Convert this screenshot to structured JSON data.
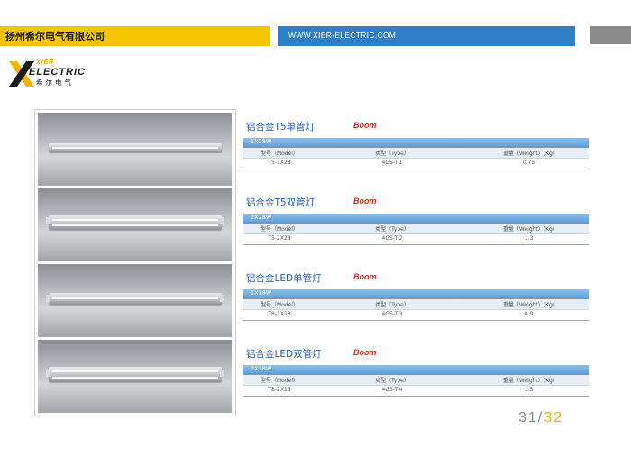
{
  "header": {
    "company_name": "扬州希尔电气有限公司",
    "url": "WWW.XIER-ELECTRIC.COM"
  },
  "logo": {
    "brand_top": "XIER",
    "brand_main": "ELECTRIC",
    "brand_cn": "希尔电气"
  },
  "products": [
    {
      "title": "铝合金T5单管灯",
      "tag": "Boom",
      "watt": "1X28W",
      "columns": [
        "型号（Model）",
        "类型（Type）",
        "重量（Weight）(Kg)"
      ],
      "values": [
        "T5-1X28",
        "4GS-T-1",
        "0.75"
      ]
    },
    {
      "title": "铝合金T5双管灯",
      "tag": "Boom",
      "watt": "2X28W",
      "columns": [
        "型号（Model）",
        "类型（Type）",
        "重量（Weight）(Kg)"
      ],
      "values": [
        "T5-2X28",
        "4GS-T-2",
        "1.3"
      ]
    },
    {
      "title": "铝合金LED单管灯",
      "tag": "Boom",
      "watt": "1X18W",
      "columns": [
        "型号（Model）",
        "类型（Type）",
        "重量（Weight）(Kg)"
      ],
      "values": [
        "T8-1X18",
        "4GS-T-3",
        "0.9"
      ]
    },
    {
      "title": "铝合金LED双管灯",
      "tag": "Boom",
      "watt": "2X18W",
      "columns": [
        "型号（Model）",
        "类型（Type）",
        "重量（Weight）(Kg)"
      ],
      "values": [
        "T8-2X18",
        "4GS-T-4",
        "1.5"
      ]
    }
  ],
  "pagination": {
    "current": "31",
    "separator": "/",
    "total": "32"
  },
  "colors": {
    "brand_yellow": "#f6c400",
    "brand_blue": "#2f7fc6",
    "title_blue": "#2a5db0",
    "boom_red": "#d9261c"
  }
}
